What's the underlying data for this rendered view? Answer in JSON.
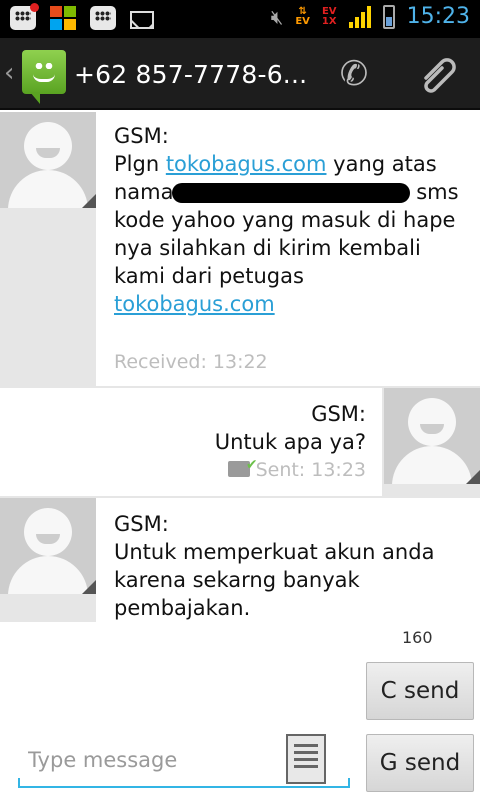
{
  "status_bar": {
    "time": "15:23",
    "ev_top": "EV",
    "ev_bottom": "EV",
    "icons": [
      "bbm-icon",
      "windows-icon",
      "bbm-icon",
      "mail-icon",
      "mute-icon",
      "data-transfer-icon",
      "signal-icon",
      "battery-icon"
    ]
  },
  "header": {
    "contact": "+62 857-7778-6..."
  },
  "messages": [
    {
      "sender": "GSM:",
      "text_1": "Plgn ",
      "link_1": "tokobagus.com",
      "text_2": " yang atas nama",
      "text_3": "sms kode yahoo yang masuk di hape nya silahkan di kirim kembali kami dari petugas",
      "link_2": "tokobagus.com",
      "time": "Received: 13:22"
    },
    {
      "sender": "GSM:",
      "text": "Untuk apa ya?",
      "time": "Sent: 13:23"
    },
    {
      "sender": "GSM:",
      "text": "Untuk memperkuat akun anda karena sekarng banyak pembajakan."
    }
  ],
  "compose": {
    "char_count": "160",
    "placeholder": "Type message",
    "c_send": "C send",
    "g_send": "G send"
  }
}
